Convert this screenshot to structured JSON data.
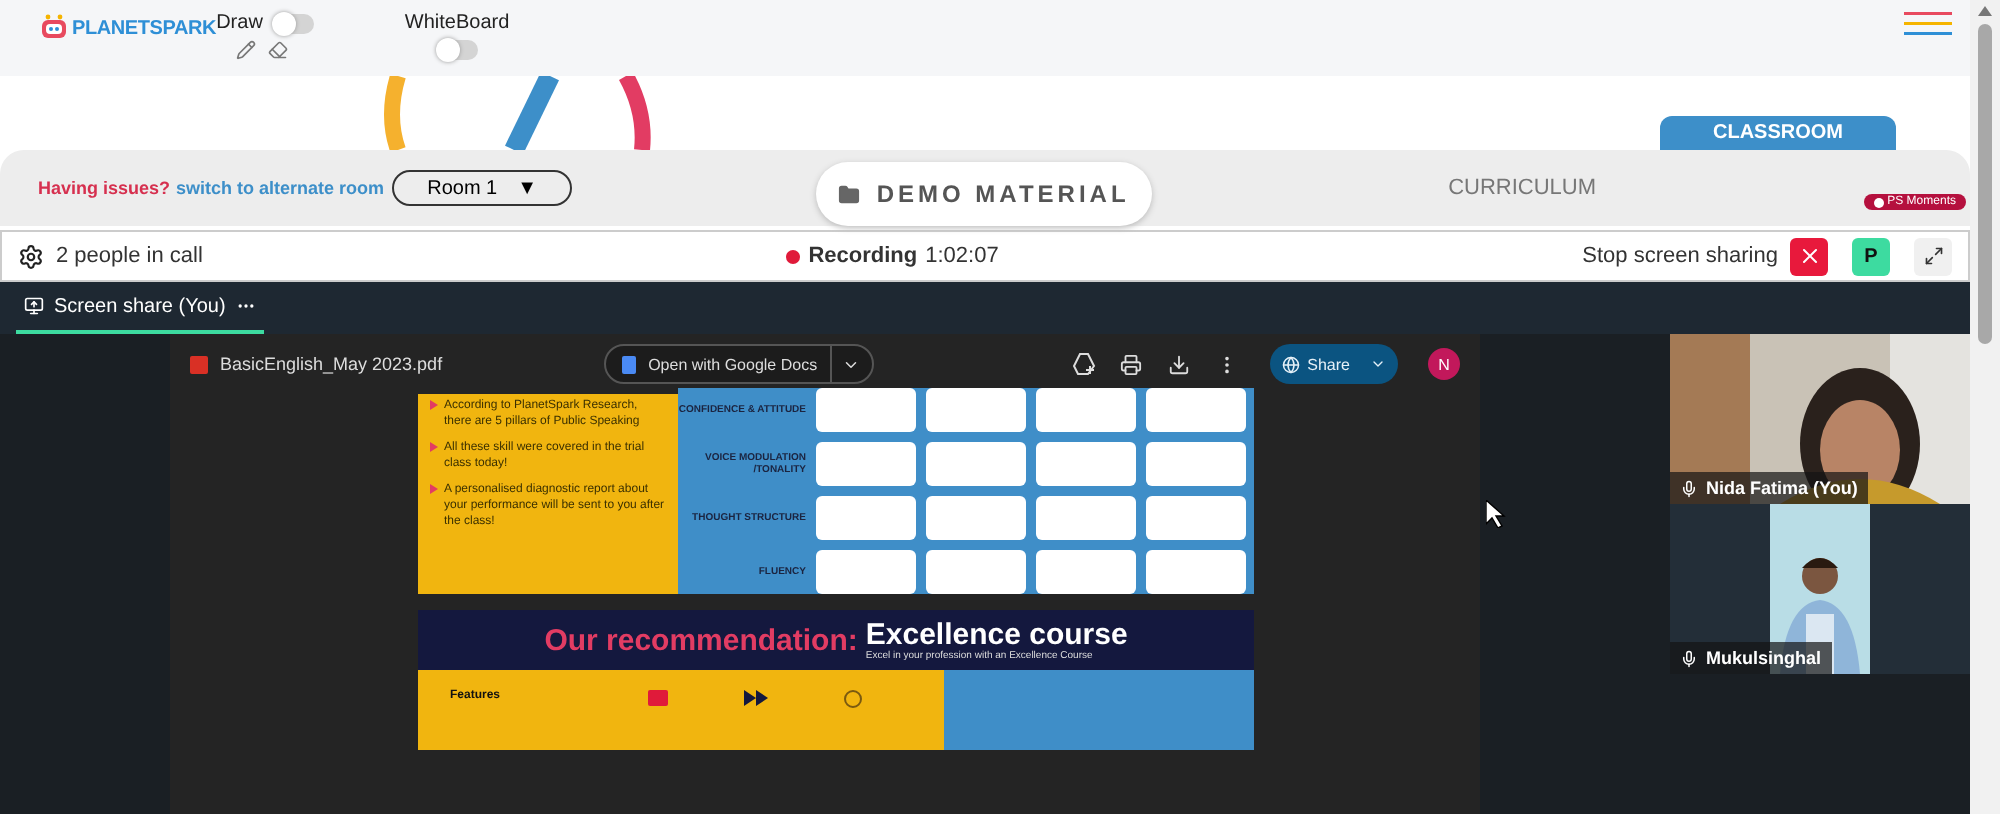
{
  "header": {
    "logo": "PLANETSPARK",
    "draw": {
      "label": "Draw",
      "on": false
    },
    "whiteboard": {
      "label": "WhiteBoard",
      "on": false
    }
  },
  "issues": {
    "question": "Having issues?",
    "link": "switch to alternate room",
    "room": "Room 1",
    "arrow": "▼"
  },
  "sections": [
    {
      "label": "DEMO MATERIAL",
      "kind": "pill",
      "selected": false
    },
    {
      "label": "CURRICULUM",
      "kind": "text",
      "selected": false
    },
    {
      "label": "CLASSROOM",
      "kind": "tab",
      "selected": true
    }
  ],
  "badge": "PS Moments",
  "call_bar": {
    "people": "2 people in call",
    "recording": "Recording",
    "time": "1:02:07",
    "stop": "Stop screen sharing",
    "avatar": "P"
  },
  "share_tab": {
    "label": "Screen share (You)",
    "selected": true
  },
  "pdf": {
    "file": "BasicEnglish_May 2023.pdf",
    "open_with": "Open with Google Docs",
    "share": "Share",
    "user": "N"
  },
  "page1": {
    "bullets": [
      "According to PlanetSpark Research, there are 5 pillars of Public Speaking",
      "All these skill were covered in the trial class today!",
      "A personalised diagnostic report about your performance will be sent to you after the class!"
    ],
    "rows": [
      "CONFIDENCE & ATTITUDE",
      "VOICE MODULATION /TONALITY",
      "THOUGHT STRUCTURE",
      "FLUENCY"
    ]
  },
  "page2": {
    "title_lead": "Our recommendation:",
    "title_course": "Excellence course",
    "subtitle": "Excel in your profession with an Excellence Course",
    "features": "Features"
  },
  "participants": [
    {
      "name": "Nida Fatima (You)",
      "kind": "her"
    },
    {
      "name": "Mukulsinghal",
      "kind": "him"
    }
  ]
}
